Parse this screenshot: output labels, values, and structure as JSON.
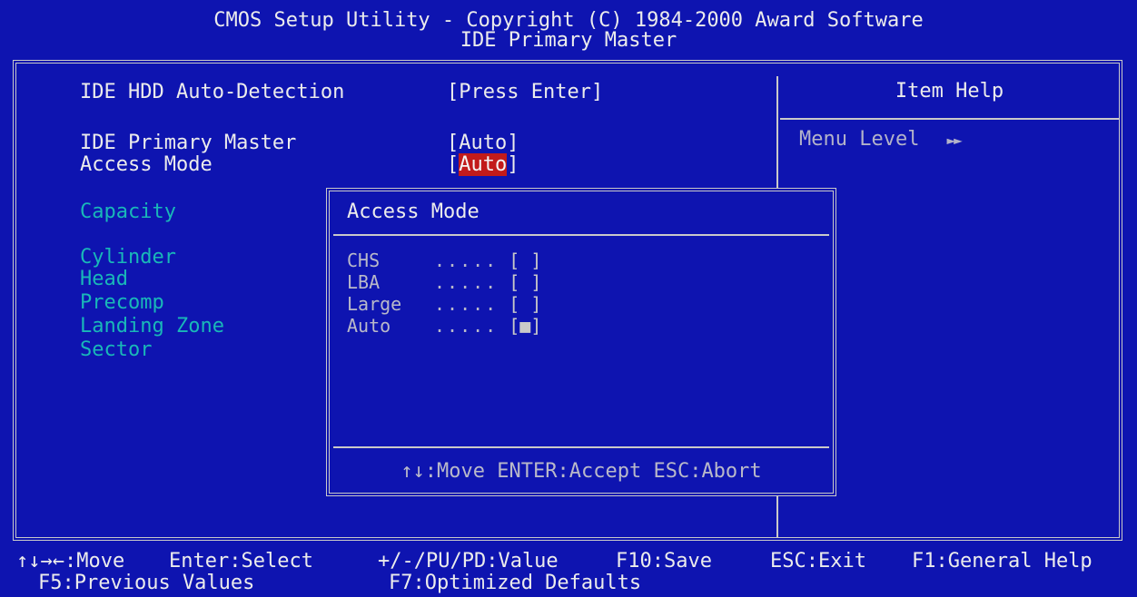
{
  "header": {
    "line1": "CMOS Setup Utility - Copyright (C) 1984-2000 Award Software",
    "line2": "IDE Primary Master"
  },
  "main": {
    "hdd_autodetect": {
      "label": "IDE HDD Auto-Detection",
      "value": "[Press Enter]"
    },
    "primary_master": {
      "label": "IDE Primary Master",
      "value": "[Auto]"
    },
    "access_mode": {
      "label": "Access Mode",
      "open_bracket": "[",
      "value": "Auto",
      "close_bracket": "]"
    },
    "disabled_items": [
      "Capacity",
      "Cylinder",
      "Head",
      "Precomp",
      "Landing Zone",
      "Sector"
    ]
  },
  "help": {
    "title": "Item Help",
    "menu_level_label": "Menu Level",
    "menu_level_arrow": "►►"
  },
  "popup": {
    "title": "Access Mode",
    "options": [
      {
        "label": "CHS",
        "dots": ".....",
        "box": "[ ]"
      },
      {
        "label": "LBA",
        "dots": ".....",
        "box": "[ ]"
      },
      {
        "label": "Large",
        "dots": ".....",
        "box": "[ ]"
      },
      {
        "label": "Auto",
        "dots": ".....",
        "box": "[■]"
      }
    ],
    "footer": "↑↓:Move ENTER:Accept ESC:Abort"
  },
  "footer": {
    "move": "↑↓→←:Move",
    "select": "Enter:Select",
    "value": "+/-/PU/PD:Value",
    "save": "F10:Save",
    "exit": "ESC:Exit",
    "help": "F1:General Help",
    "prev": "F5:Previous Values",
    "optimized": "F7:Optimized Defaults"
  },
  "colors": {
    "background": "#0e14b0",
    "highlight": "#c21b1b",
    "disabled_text": "#19b8b8"
  }
}
